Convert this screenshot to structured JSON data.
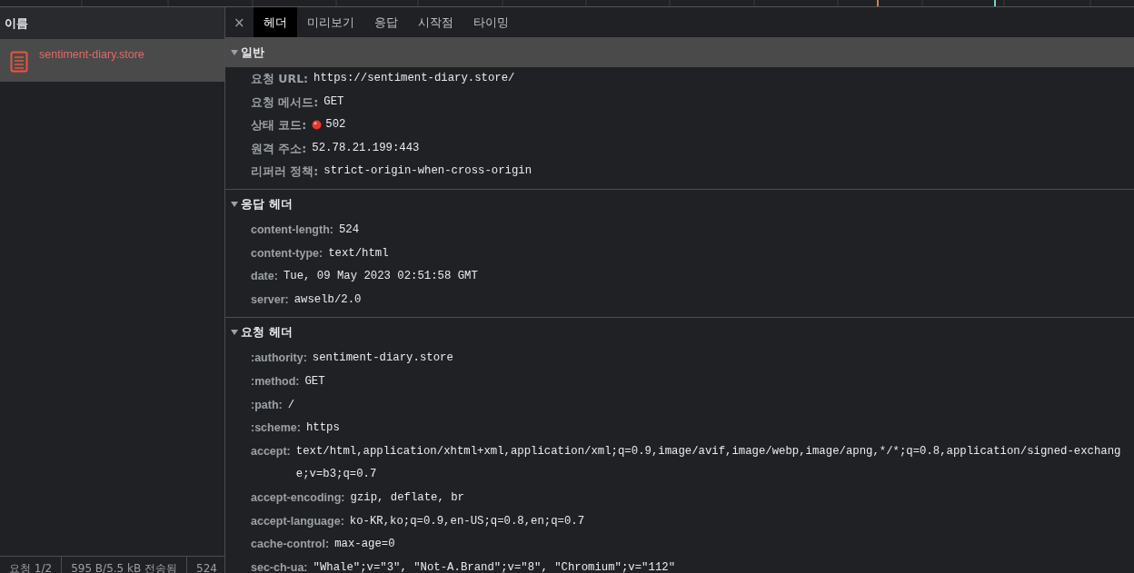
{
  "requests": {
    "column_title": "이름",
    "items": [
      {
        "name": "sentiment-diary.store",
        "selected": true,
        "error": true
      }
    ]
  },
  "status_bar": [
    "요청 1/2",
    "595 B/5.5 kB 전송됨",
    "524"
  ],
  "close": "×",
  "tabs": [
    {
      "label": "헤더",
      "selected": true
    },
    {
      "label": "미리보기",
      "selected": false
    },
    {
      "label": "응답",
      "selected": false
    },
    {
      "label": "시작점",
      "selected": false
    },
    {
      "label": "타이밍",
      "selected": false
    }
  ],
  "sections": [
    {
      "title": "일반",
      "expanded": true,
      "focused": true,
      "kind": "general",
      "rows": [
        {
          "key": "요청 URL:",
          "value": "https://sentiment-diary.store/"
        },
        {
          "key": "요청 메서드:",
          "value": "GET"
        },
        {
          "key": "상태 코드:",
          "value": "502",
          "error": true
        },
        {
          "key": "원격 주소:",
          "value": "52.78.21.199:443"
        },
        {
          "key": "리퍼러 정책:",
          "value": "strict-origin-when-cross-origin"
        }
      ]
    },
    {
      "title": "응답 헤더",
      "expanded": true,
      "focused": false,
      "kind": "headers",
      "rows": [
        {
          "key": "content-length:",
          "value": "524"
        },
        {
          "key": "content-type:",
          "value": "text/html"
        },
        {
          "key": "date:",
          "value": "Tue, 09 May 2023 02:51:58 GMT"
        },
        {
          "key": "server:",
          "value": "awselb/2.0"
        }
      ]
    },
    {
      "title": "요청 헤더",
      "expanded": true,
      "focused": false,
      "kind": "headers",
      "rows": [
        {
          "key": ":authority:",
          "value": "sentiment-diary.store"
        },
        {
          "key": ":method:",
          "value": "GET"
        },
        {
          "key": ":path:",
          "value": "/"
        },
        {
          "key": ":scheme:",
          "value": "https"
        },
        {
          "key": "accept:",
          "value": "text/html,application/xhtml+xml,application/xml;q=0.9,image/avif,image/webp,image/apng,*/*;q=0.8,application/signed-exchange;v=b3;q=0.7"
        },
        {
          "key": "accept-encoding:",
          "value": "gzip, deflate, br"
        },
        {
          "key": "accept-language:",
          "value": "ko-KR,ko;q=0.9,en-US;q=0.8,en;q=0.7"
        },
        {
          "key": "cache-control:",
          "value": "max-age=0"
        },
        {
          "key": "sec-ch-ua:",
          "value": "\"Whale\";v=\"3\", \"Not-A.Brand\";v=\"8\", \"Chromium\";v=\"112\""
        }
      ]
    }
  ]
}
